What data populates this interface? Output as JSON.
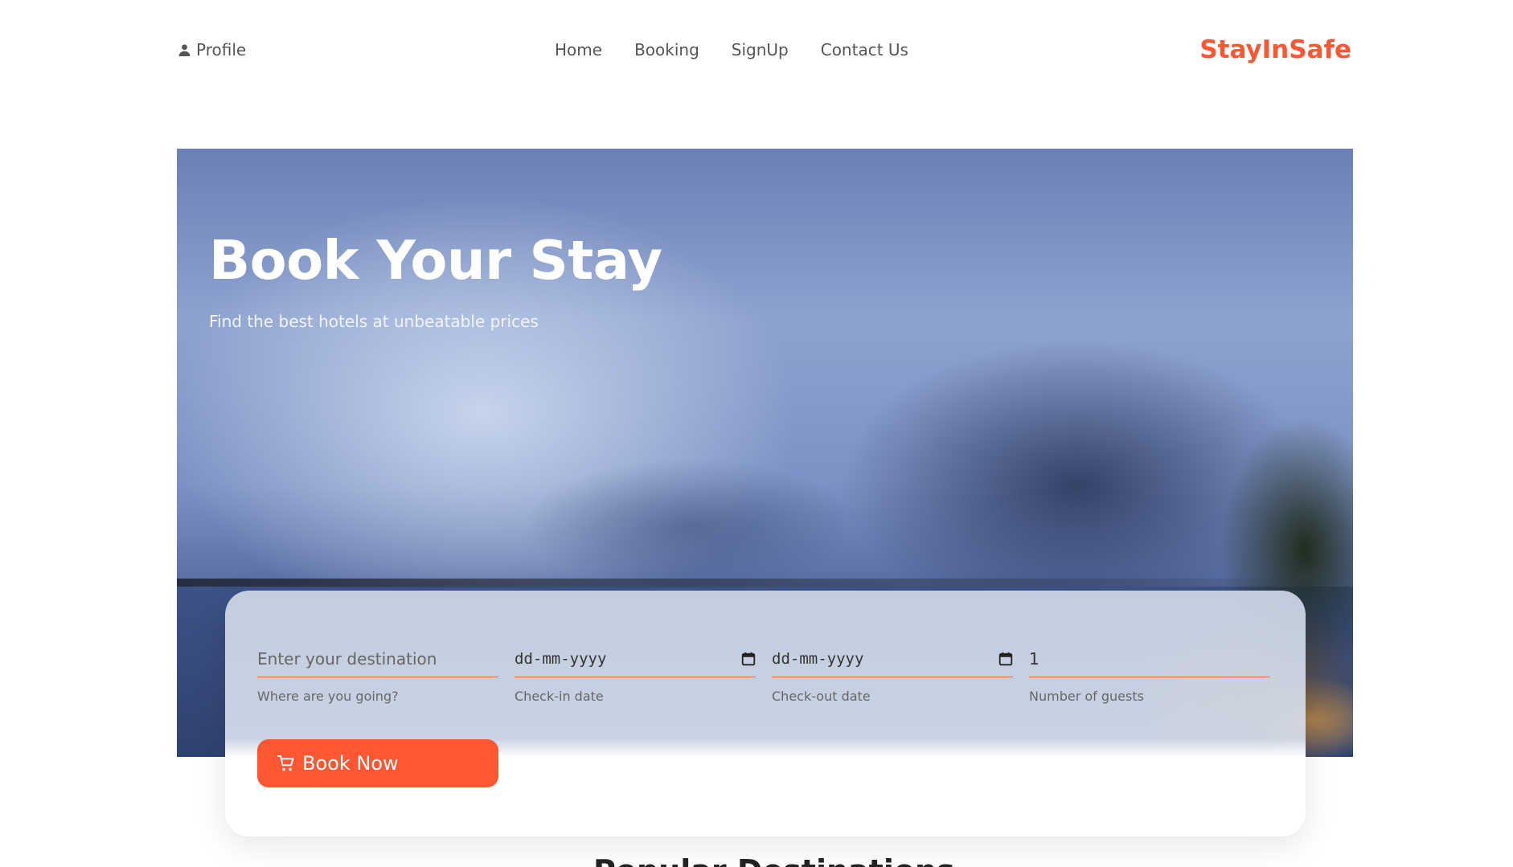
{
  "header": {
    "profile_label": "Profile",
    "nav": [
      "Home",
      "Booking",
      "SignUp",
      "Contact Us"
    ],
    "brand": "StayInSafe",
    "brand_color": "#ff5733"
  },
  "hero": {
    "title": "Book Your Stay",
    "subtitle": "Find the best hotels at unbeatable prices"
  },
  "booking_form": {
    "destination": {
      "placeholder": "Enter your destination",
      "helper": "Where are you going?"
    },
    "checkin": {
      "value": "dd-mm-yyyy",
      "helper": "Check-in date",
      "icon": "calendar-icon"
    },
    "checkout": {
      "value": "dd-mm-yyyy",
      "helper": "Check-out date",
      "icon": "calendar-icon"
    },
    "guests": {
      "value": "1",
      "helper": "Number of guests"
    },
    "submit_label": "Book Now",
    "submit_icon": "cart-icon"
  },
  "next_section": {
    "title": "Popular Destinations"
  }
}
